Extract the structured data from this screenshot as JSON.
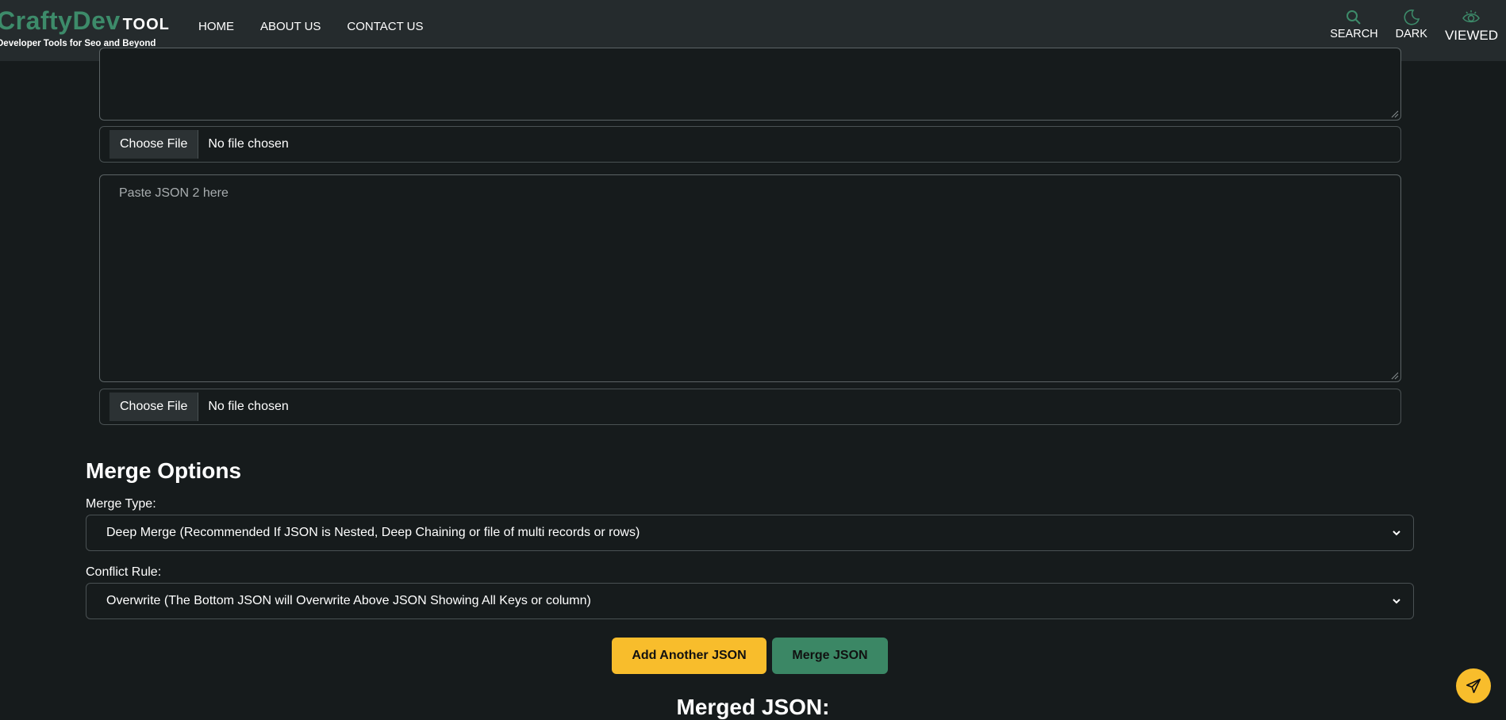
{
  "brand": {
    "name_part1": "CraftyDev",
    "name_part2": "TOOL",
    "tagline": "Developer Tools for Seo and Beyond"
  },
  "nav": {
    "links": [
      "HOME",
      "ABOUT US",
      "CONTACT US"
    ],
    "tools": [
      {
        "label": "SEARCH",
        "icon": "search-icon"
      },
      {
        "label": "DARK",
        "icon": "moon-icon"
      },
      {
        "label": "VIEWED",
        "icon": "eye-icon"
      }
    ]
  },
  "json_inputs": {
    "json1": {
      "file_button": "Choose File",
      "file_status": "No file chosen"
    },
    "json2": {
      "placeholder": "Paste JSON 2 here",
      "file_button": "Choose File",
      "file_status": "No file chosen"
    }
  },
  "merge_options": {
    "title": "Merge Options",
    "merge_type_label": "Merge Type:",
    "merge_type_value": "Deep Merge (Recommended If JSON is Nested, Deep Chaining or file of multi records or rows)",
    "conflict_rule_label": "Conflict Rule:",
    "conflict_rule_value": "Overwrite (The Bottom JSON will Overwrite Above JSON Showing All Keys or column)"
  },
  "actions": {
    "add_label": "Add Another JSON",
    "merge_label": "Merge JSON"
  },
  "result": {
    "title": "Merged JSON:"
  },
  "colors": {
    "background": "#161b1c",
    "navbar": "#252b2d",
    "brand_green": "#3d8b6a",
    "accent_yellow": "#f8bd2c",
    "merge_green": "#3b8765"
  }
}
